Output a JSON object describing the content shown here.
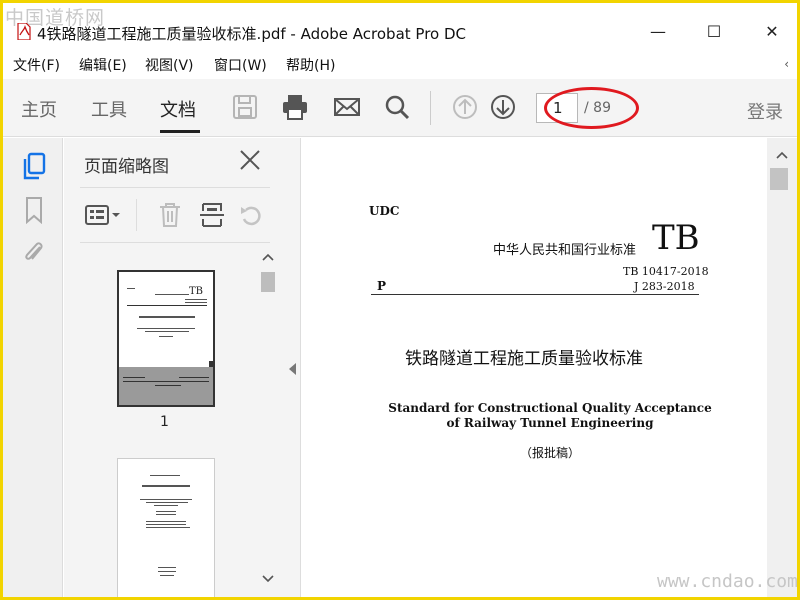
{
  "watermark_top": "中国道桥网",
  "watermark_bottom": "www.cndao.com",
  "window": {
    "title": "4铁路隧道工程施工质量验收标准.pdf - Adobe Acrobat Pro DC",
    "minimize": "—",
    "maximize": "☐",
    "close": "✕"
  },
  "menu": [
    "文件(F)",
    "编辑(E)",
    "视图(V)",
    "窗口(W)",
    "帮助(H)"
  ],
  "toolbar": {
    "tabs": [
      "主页",
      "工具",
      "文档"
    ],
    "active_tab": "文档",
    "icons": [
      "save-icon",
      "print-icon",
      "mail-icon",
      "search-icon",
      "page-up-icon",
      "page-down-icon"
    ],
    "page_current": "1",
    "page_total": "/ 89",
    "login": "登录"
  },
  "left_rail": [
    "page-thumbnails-icon",
    "bookmark-icon",
    "attachment-icon"
  ],
  "thumb_panel": {
    "title": "页面缩略图",
    "tools": [
      "options-icon",
      "delete-icon",
      "extract-icon",
      "rotate-icon"
    ],
    "pages": [
      "1"
    ],
    "selected_page": "1"
  },
  "document": {
    "udc": "UDC",
    "std_cn": "中华人民共和国行业标准",
    "tb": "TB",
    "std_no": "TB 10417-2018",
    "p": "P",
    "std_no2": "J 283-2018",
    "title_cn": "铁路隧道工程施工质量验收标准",
    "title_en_1": "Standard for Constructional Quality Acceptance",
    "title_en_2": "of Railway Tunnel Engineering",
    "draft": "（报批稿）"
  },
  "colors": {
    "frame": "#f2d400",
    "highlight_ellipse": "#e0191f",
    "accent_blue": "#1473e6"
  }
}
